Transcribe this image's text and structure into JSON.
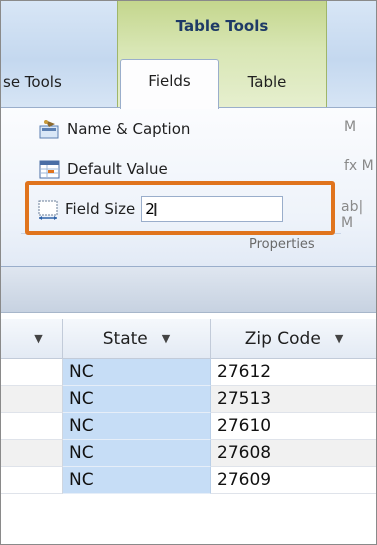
{
  "ribbon": {
    "context_title": "Table Tools",
    "tabs": [
      "se Tools",
      "Fields",
      "Table"
    ],
    "commands": {
      "name_caption": "Name & Caption",
      "default_value": "Default Value",
      "field_size_label": "Field Size",
      "field_size_value": "2"
    },
    "group_label": "Properties",
    "side_glyphs": [
      "M",
      "fx M",
      "ab| M"
    ]
  },
  "table": {
    "columns": [
      "",
      "State",
      "Zip Code"
    ],
    "rows": [
      {
        "state": "NC",
        "zip": "27612"
      },
      {
        "state": "NC",
        "zip": "27513"
      },
      {
        "state": "NC",
        "zip": "27610"
      },
      {
        "state": "NC",
        "zip": "27608"
      },
      {
        "state": "NC",
        "zip": "27609"
      }
    ]
  },
  "colors": {
    "highlight": "#e0741d",
    "selected_column": "#c6ddf6",
    "context_group": "#c4d68d"
  }
}
